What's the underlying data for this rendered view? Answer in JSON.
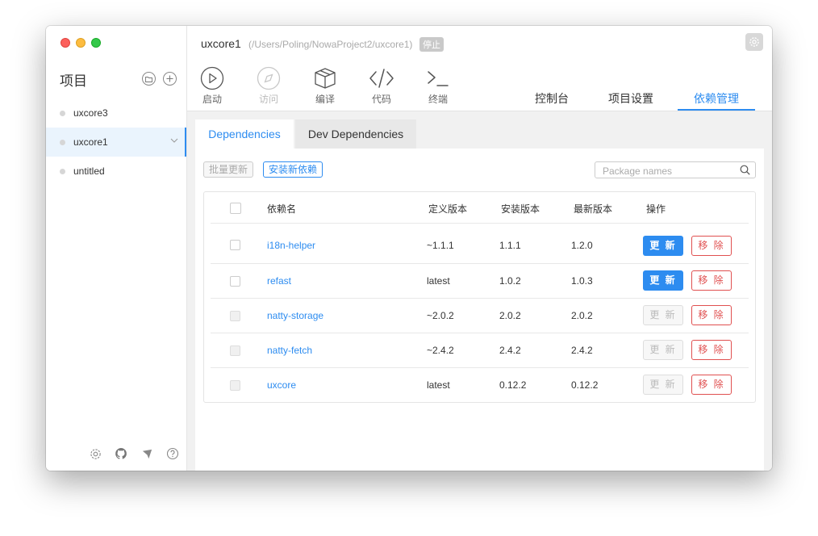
{
  "sidebar": {
    "title": "项目",
    "items": [
      {
        "label": "uxcore3"
      },
      {
        "label": "uxcore1"
      },
      {
        "label": "untitled"
      }
    ]
  },
  "header": {
    "project_name": "uxcore1",
    "project_path": "(/Users/Poling/NowaProject2/uxcore1)",
    "status_badge": "停止"
  },
  "toolbar": {
    "start_label": "启动",
    "visit_label": "访问",
    "compile_label": "编译",
    "code_label": "代码",
    "terminal_label": "终端"
  },
  "nav_tabs": [
    {
      "label": "控制台"
    },
    {
      "label": "项目设置"
    },
    {
      "label": "依赖管理"
    }
  ],
  "sub_tabs": [
    {
      "label": "Dependencies"
    },
    {
      "label": "Dev Dependencies"
    }
  ],
  "actions": {
    "batch_update_label": "批量更新",
    "install_label": "安装新依赖"
  },
  "search": {
    "placeholder": "Package names"
  },
  "table": {
    "headers": [
      "依赖名",
      "定义版本",
      "安装版本",
      "最新版本",
      "操作"
    ],
    "update_label": "更 新",
    "remove_label": "移 除",
    "rows": [
      {
        "name": "i18n-helper",
        "defined": "~1.1.1",
        "installed": "1.1.1",
        "latest": "1.2.0",
        "update_enabled": true
      },
      {
        "name": "refast",
        "defined": "latest",
        "installed": "1.0.2",
        "latest": "1.0.3",
        "update_enabled": true
      },
      {
        "name": "natty-storage",
        "defined": "~2.0.2",
        "installed": "2.0.2",
        "latest": "2.0.2",
        "update_enabled": false
      },
      {
        "name": "natty-fetch",
        "defined": "~2.4.2",
        "installed": "2.4.2",
        "latest": "2.4.2",
        "update_enabled": false
      },
      {
        "name": "uxcore",
        "defined": "latest",
        "installed": "0.12.2",
        "latest": "0.12.2",
        "update_enabled": false
      }
    ]
  },
  "colors": {
    "accent": "#2d8cf0",
    "danger": "#e05050"
  }
}
